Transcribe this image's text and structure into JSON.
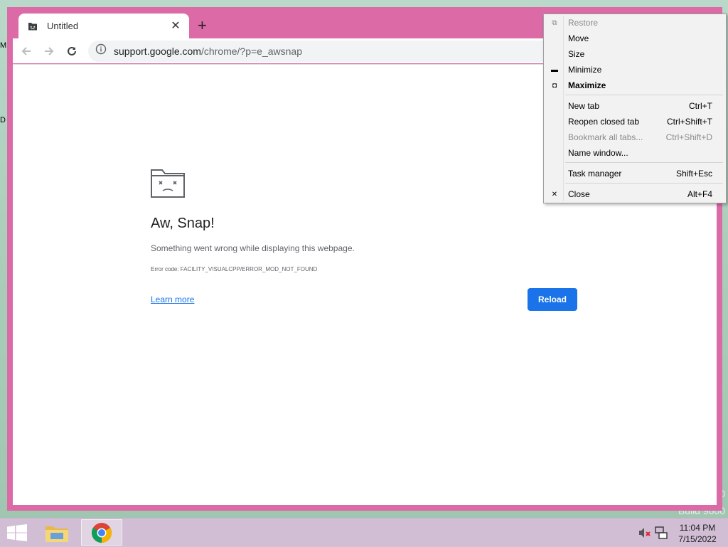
{
  "desktop": {
    "left_label_1": "M",
    "left_label_2": "D",
    "build_text_1": "0",
    "build_text_2": "Build 9600"
  },
  "browser": {
    "tab": {
      "title": "Untitled",
      "icon": "sad-tab-icon",
      "close_glyph": "✕"
    },
    "new_tab_glyph": "+",
    "toolbar": {
      "back_icon": "back-arrow-icon",
      "forward_icon": "forward-arrow-icon",
      "reload_icon": "reload-icon",
      "info_icon": "info-icon",
      "url_host": "support.google.com",
      "url_path": "/chrome/?p=e_awsnap"
    },
    "page": {
      "icon": "sad-folder-icon",
      "title": "Aw, Snap!",
      "description": "Something went wrong while displaying this webpage.",
      "error_code": "Error code: FACILITY_VISUALCPP/ERROR_MOD_NOT_FOUND",
      "learn_more": "Learn more",
      "reload_button": "Reload"
    },
    "accent_color": "#1a73e8",
    "frame_color": "#dc6aa6"
  },
  "system_menu": {
    "items": [
      {
        "label": "Restore",
        "shortcut": "",
        "glyph": "restore-icon",
        "disabled": true
      },
      {
        "label": "Move",
        "shortcut": "",
        "glyph": "",
        "disabled": false
      },
      {
        "label": "Size",
        "shortcut": "",
        "glyph": "",
        "disabled": false
      },
      {
        "label": "Minimize",
        "shortcut": "",
        "glyph": "minimize-icon",
        "disabled": false
      },
      {
        "label": "Maximize",
        "shortcut": "",
        "glyph": "maximize-icon",
        "disabled": false,
        "bold": true
      },
      {
        "label": "New tab",
        "shortcut": "Ctrl+T",
        "glyph": "",
        "disabled": false
      },
      {
        "label": "Reopen closed tab",
        "shortcut": "Ctrl+Shift+T",
        "glyph": "",
        "disabled": false
      },
      {
        "label": "Bookmark all tabs...",
        "shortcut": "Ctrl+Shift+D",
        "glyph": "",
        "disabled": true
      },
      {
        "label": "Name window...",
        "shortcut": "",
        "glyph": "",
        "disabled": false
      },
      {
        "label": "Task manager",
        "shortcut": "Shift+Esc",
        "glyph": "",
        "disabled": false
      },
      {
        "label": "Close",
        "shortcut": "Alt+F4",
        "glyph": "close-icon",
        "disabled": false
      }
    ]
  },
  "taskbar": {
    "start_icon": "windows-start-icon",
    "file_explorer_icon": "file-explorer-icon",
    "chrome_icon": "chrome-icon",
    "speaker_icon": "speaker-muted-icon",
    "network_icon": "network-icon",
    "time": "11:04 PM",
    "date": "7/15/2022"
  }
}
